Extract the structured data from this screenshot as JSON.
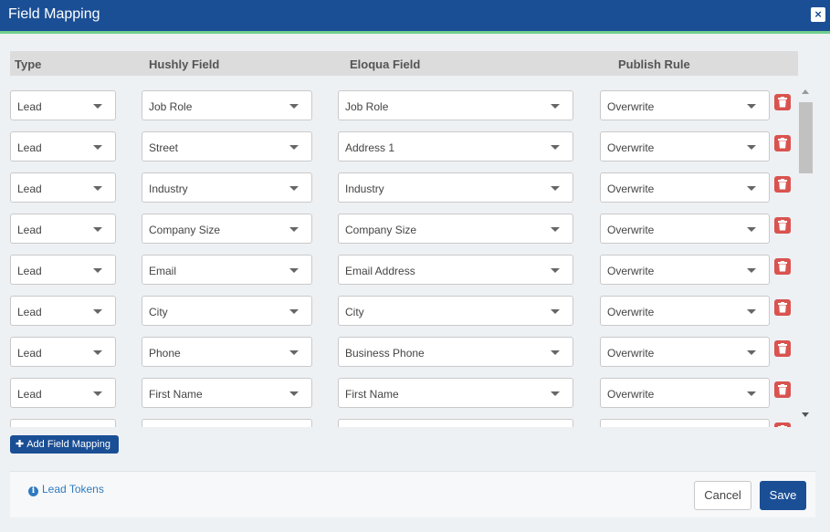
{
  "window": {
    "title": "Field Mapping",
    "close_icon": "close-icon"
  },
  "columns": {
    "type": "Type",
    "hushly": "Hushly Field",
    "eloqua": "Eloqua Field",
    "rule": "Publish Rule"
  },
  "rows": [
    {
      "type": "Lead",
      "hushly": "Job Role",
      "eloqua": "Job Role",
      "rule": "Overwrite"
    },
    {
      "type": "Lead",
      "hushly": "Street",
      "eloqua": "Address 1",
      "rule": "Overwrite"
    },
    {
      "type": "Lead",
      "hushly": "Industry",
      "eloqua": "Industry",
      "rule": "Overwrite"
    },
    {
      "type": "Lead",
      "hushly": "Company Size",
      "eloqua": "Company Size",
      "rule": "Overwrite"
    },
    {
      "type": "Lead",
      "hushly": "Email",
      "eloqua": "Email Address",
      "rule": "Overwrite"
    },
    {
      "type": "Lead",
      "hushly": "City",
      "eloqua": "City",
      "rule": "Overwrite"
    },
    {
      "type": "Lead",
      "hushly": "Phone",
      "eloqua": "Business Phone",
      "rule": "Overwrite"
    },
    {
      "type": "Lead",
      "hushly": "First Name",
      "eloqua": "First Name",
      "rule": "Overwrite"
    },
    {
      "type": "",
      "hushly": "",
      "eloqua": "",
      "rule": ""
    }
  ],
  "buttons": {
    "add": "Add Field Mapping",
    "cancel": "Cancel",
    "save": "Save"
  },
  "footer": {
    "tokens": "Lead Tokens"
  },
  "colors": {
    "primary": "#1b4f95",
    "accent": "#6fcf8c",
    "danger": "#d9534f",
    "link": "#2f7bbf"
  }
}
